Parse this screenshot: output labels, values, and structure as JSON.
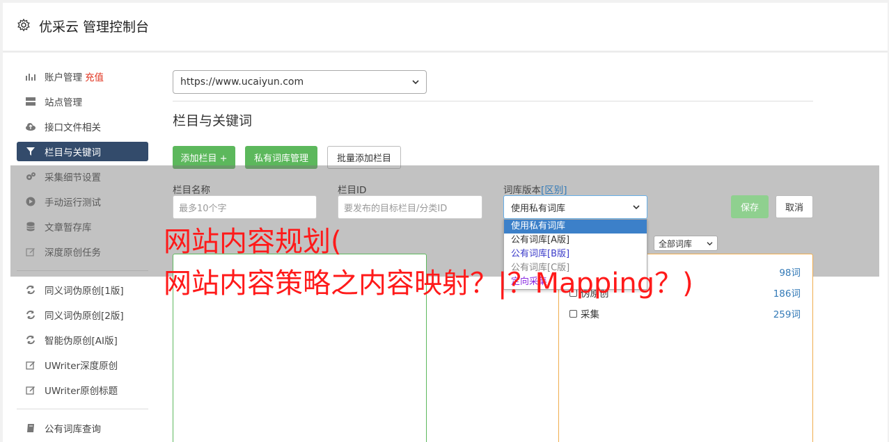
{
  "header": {
    "title": "优采云 管理控制台"
  },
  "sidebar": {
    "items": [
      {
        "icon": "bar-chart-icon",
        "label": "账户管理",
        "extra": "充值"
      },
      {
        "icon": "server-icon",
        "label": "站点管理"
      },
      {
        "icon": "cloud-upload-icon",
        "label": "接口文件相关"
      },
      {
        "icon": "filter-icon",
        "label": "栏目与关键词"
      },
      {
        "icon": "gears-icon",
        "label": "采集细节设置"
      },
      {
        "icon": "play-icon",
        "label": "手动运行测试"
      },
      {
        "icon": "database-icon",
        "label": "文章暂存库"
      },
      {
        "icon": "edit-icon",
        "label": "深度原创任务"
      },
      {
        "icon": "refresh-icon",
        "label": "同义词伪原创[1版]"
      },
      {
        "icon": "refresh-icon",
        "label": "同义词伪原创[2版]"
      },
      {
        "icon": "refresh-icon",
        "label": "智能伪原创[AI版]"
      },
      {
        "icon": "edit-icon",
        "label": "UWriter深度原创"
      },
      {
        "icon": "edit-icon",
        "label": "UWriter原创标题"
      },
      {
        "icon": "book-icon",
        "label": "公有词库查询"
      }
    ]
  },
  "main": {
    "site_select": "https://www.ucaiyun.com",
    "section_title": "栏目与关键词",
    "buttons": {
      "add_column": "添加栏目 +",
      "private_lib": "私有词库管理",
      "batch_add": "批量添加栏目"
    },
    "form": {
      "name_label": "栏目名称",
      "name_placeholder": "最多10个字",
      "id_label": "栏目ID",
      "id_placeholder": "要发布的目标栏目/分类ID",
      "lib_label": "词库版本",
      "lib_diff": "[区别]",
      "lib_value": "使用私有词库",
      "save": "保存",
      "cancel": "取消"
    },
    "dropdown": [
      "使用私有词库",
      "公有词库[A版]",
      "公有词库[B版]",
      "公有词库[C版]",
      "定向采集"
    ],
    "lib_filter": "全部词库",
    "lib_rows": [
      {
        "label": "伪原创",
        "count": "186词"
      },
      {
        "label": "采集",
        "count": "259词"
      }
    ],
    "first_count": "98词"
  },
  "watermark": {
    "line1": "网站内容规划(",
    "line2": "网站内容策略之内容映射？|？Mapping？)"
  }
}
